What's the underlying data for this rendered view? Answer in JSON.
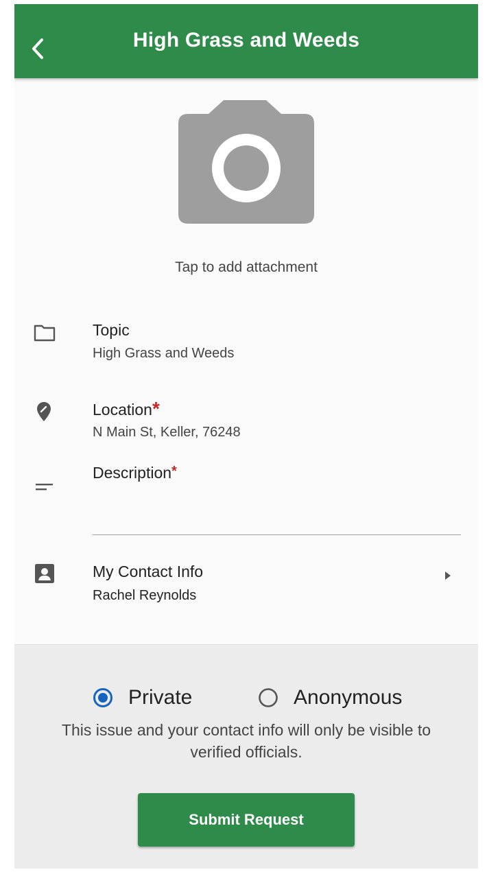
{
  "header": {
    "title": "High Grass and Weeds",
    "back_icon": "chevron-left-icon"
  },
  "attachment": {
    "label": "Tap to add attachment",
    "icon": "camera-icon"
  },
  "topic": {
    "label": "Topic",
    "value": "High Grass and Weeds",
    "icon": "folder-icon"
  },
  "location": {
    "label": "Location",
    "required_mark": "*",
    "value": "N Main St, Keller, 76248",
    "icon": "location-pin-icon"
  },
  "description": {
    "label": "Description",
    "required_mark": "*",
    "value": "",
    "icon": "notes-icon"
  },
  "contact": {
    "label": "My Contact Info",
    "value": "Rachel Reynolds",
    "icon": "contact-card-icon"
  },
  "privacy": {
    "options": [
      {
        "label": "Private",
        "selected": true
      },
      {
        "label": "Anonymous",
        "selected": false
      }
    ],
    "notice": "This issue and your contact info will only be visible to verified officials."
  },
  "submit_label": "Submit Request",
  "colors": {
    "primary": "#2e8b4a",
    "radio_selected": "#1565c0",
    "required": "#c62828"
  }
}
